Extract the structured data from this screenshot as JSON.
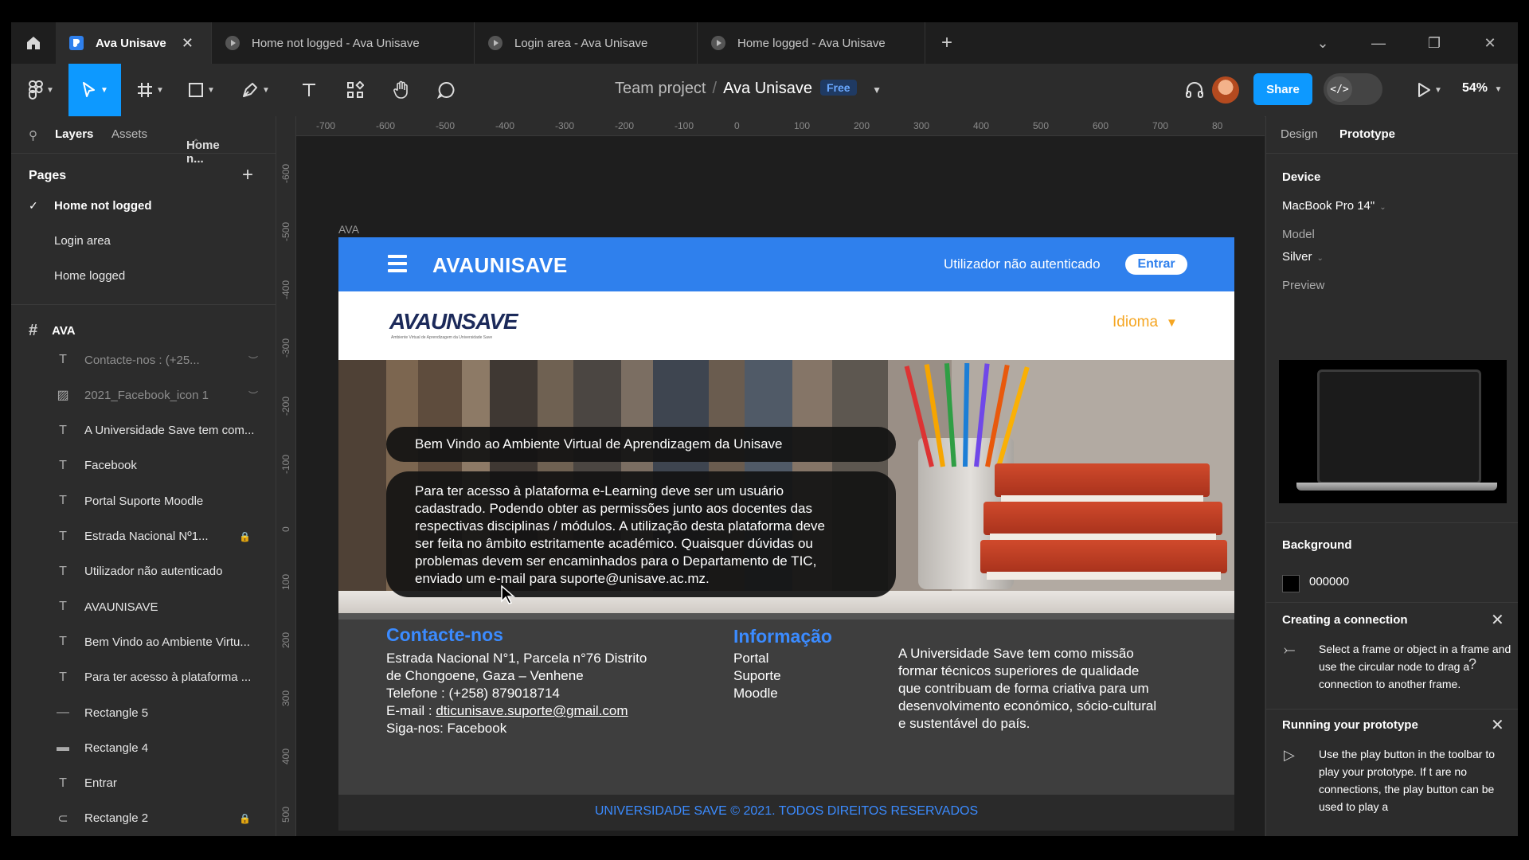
{
  "tabs": [
    {
      "label": "Ava Unisave",
      "active": true
    },
    {
      "label": "Home not logged - Ava Unisave",
      "active": false
    },
    {
      "label": "Login area - Ava Unisave",
      "active": false
    },
    {
      "label": "Home logged - Ava Unisave",
      "active": false
    }
  ],
  "toolbar": {
    "team": "Team project",
    "file": "Ava Unisave",
    "plan_badge": "Free",
    "share_label": "Share",
    "zoom": "54%"
  },
  "left_panel": {
    "tabs": {
      "layers": "Layers",
      "assets": "Assets",
      "page": "Home n..."
    },
    "pages_title": "Pages",
    "pages": [
      "Home not logged",
      "Login area",
      "Home logged"
    ],
    "frame_name": "AVA",
    "layers": [
      {
        "name": "Contacte-nos : (+25...",
        "icon": "text",
        "dim": true
      },
      {
        "name": "2021_Facebook_icon 1",
        "icon": "image",
        "dim": true
      },
      {
        "name": "A Universidade Save tem com...",
        "icon": "text",
        "dim": false
      },
      {
        "name": "Facebook",
        "icon": "text",
        "dim": false
      },
      {
        "name": "Portal Suporte Moodle",
        "icon": "text",
        "dim": false
      },
      {
        "name": "Estrada Nacional Nº1...",
        "icon": "text",
        "dim": false,
        "locked": true
      },
      {
        "name": "Utilizador não autenticado",
        "icon": "text",
        "dim": false
      },
      {
        "name": "AVAUNISAVE",
        "icon": "text",
        "dim": false
      },
      {
        "name": "Bem Vindo ao Ambiente Virtu...",
        "icon": "text",
        "dim": false
      },
      {
        "name": "Para ter acesso à plataforma ...",
        "icon": "text",
        "dim": false
      },
      {
        "name": "Rectangle 5",
        "icon": "line",
        "dim": false
      },
      {
        "name": "Rectangle 4",
        "icon": "rect",
        "dim": false
      },
      {
        "name": "Entrar",
        "icon": "text",
        "dim": false
      },
      {
        "name": "Rectangle 2",
        "icon": "rect-rounded",
        "dim": false,
        "locked": true
      }
    ]
  },
  "canvas": {
    "ruler_x": [
      "-700",
      "-600",
      "-500",
      "-400",
      "-300",
      "-200",
      "-100",
      "0",
      "100",
      "200",
      "300",
      "400",
      "500",
      "600",
      "700",
      "80"
    ],
    "ruler_y": [
      "-600",
      "-500",
      "-400",
      "-300",
      "-200",
      "-100",
      "0",
      "100",
      "200",
      "300",
      "400",
      "500"
    ],
    "frame_label": "AVA"
  },
  "ava": {
    "brand": "AVAUNISAVE",
    "user_status": "Utilizador não autenticado",
    "login_button": "Entrar",
    "logo_text": "AVAUNSAVE",
    "logo_subtitle": "Ambiente Virtual de Aprendizagem da Universidade Save",
    "language": "Idioma",
    "welcome": "Bem Vindo ao Ambiente Virtual de Aprendizagem da Unisave",
    "intro_lines": [
      "Para ter acesso à plataforma e-Learning deve ser um usuário",
      "cadastrado. Podendo obter as permissões junto aos docentes das",
      "respectivas disciplinas / módulos. A utilização desta plataforma deve",
      "ser feita no âmbito estritamente académico. Quaisquer dúvidas ou",
      "problemas devem ser encaminhados para o Departamento de TIC,",
      "enviado um e-mail para suporte@unisave.ac.mz."
    ],
    "contact_title": "Contacte-nos",
    "contact_lines": [
      "Estrada Nacional N°1, Parcela n°76 Distrito",
      "de Chongoene, Gaza – Venhene",
      "Telefone : (+258) 879018714"
    ],
    "email_label": "E-mail : ",
    "email": "dticunisave.suporte@gmail.com",
    "follow": "Siga-nos:  Facebook",
    "info_title": "Informação",
    "info_links": [
      "Portal",
      "Suporte",
      "Moodle"
    ],
    "mission_lines": [
      "A Universidade Save tem como missão",
      "formar técnicos superiores de qualidade",
      "que contribuam de forma criativa para um",
      "desenvolvimento económico, sócio-cultural",
      "e sustentável do país."
    ],
    "copyright": "UNIVERSIDADE SAVE © 2021. TODOS DIREITOS RESERVADOS"
  },
  "right_panel": {
    "tabs": {
      "design": "Design",
      "prototype": "Prototype"
    },
    "device_title": "Device",
    "device": "MacBook Pro 14\"",
    "model_label": "Model",
    "model": "Silver",
    "preview_label": "Preview",
    "background_title": "Background",
    "background_hex": "000000",
    "connection_title": "Creating a connection",
    "connection_text": "Select a frame or object in a frame and use the circular node to drag a connection to another frame.",
    "running_title": "Running your prototype",
    "running_text": "Use the play button in the toolbar to play your prototype. If t are no connections, the play button can be used to play a"
  },
  "colors": {
    "accent": "#0d99ff",
    "ava_blue": "#2f80ed",
    "idioma_orange": "#f5a623",
    "footer_link_blue": "#3b8bff"
  }
}
